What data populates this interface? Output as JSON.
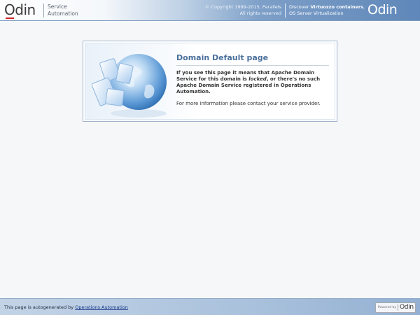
{
  "header": {
    "logo": "Odin",
    "product_line1": "Service",
    "product_line2": "Automation",
    "copyright_line1": "© Copyright 1999-2015, Parallels",
    "copyright_line2": "All rights reserved",
    "discover_prefix": "Discover ",
    "discover_bold": "Virtuozzo containers",
    "discover_suffix": ",",
    "discover_line2": "OS Server Virtualization",
    "logo_right": "Odin"
  },
  "panel": {
    "title": "Domain Default page",
    "body_part1": "If you see this page it means that Apache Domain Service for this domain is ",
    "body_em": "locked",
    "body_part2": ", or there's no such Apache Domain Service registered in Operations Automation.",
    "more_info": "For more information please contact your service provider."
  },
  "footer": {
    "text_prefix": "This page is autogenerated by ",
    "link_text": "Operations Automation",
    "powered_label": "Powered by",
    "powered_logo": "Odin"
  },
  "colors": {
    "accent": "#4a6f9b",
    "brand_red": "#d2232a",
    "link": "#1a3b8b"
  }
}
